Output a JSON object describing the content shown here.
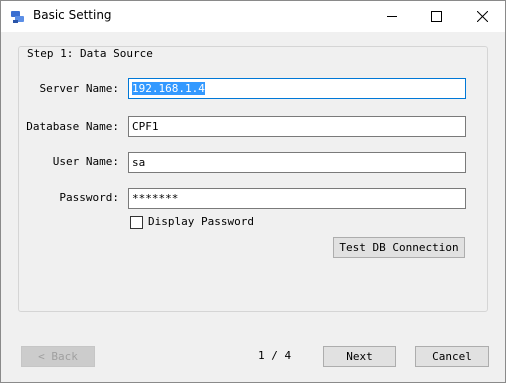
{
  "window": {
    "title": "Basic Setting"
  },
  "controls": {
    "minimize": "minimize",
    "maximize": "maximize",
    "close": "close"
  },
  "group": {
    "legend": "Step 1: Data Source"
  },
  "form": {
    "server_label": "Server Name:",
    "server_value": "192.168.1.4",
    "database_label": "Database Name:",
    "database_value": "CPF1",
    "user_label": "User Name:",
    "user_value": "sa",
    "password_label": "Password:",
    "password_value": "*******",
    "display_password_label": "Display Password",
    "display_password_checked": false,
    "test_button": "Test DB Connection"
  },
  "footer": {
    "back_label": "< Back",
    "page_indicator": "1 / 4",
    "next_label": "Next",
    "cancel_label": "Cancel"
  },
  "colors": {
    "selection": "#3399ff",
    "focus_border": "#0078d7",
    "icon": "#3b6fd1"
  },
  "icons": {
    "app": "database-settings-icon"
  }
}
